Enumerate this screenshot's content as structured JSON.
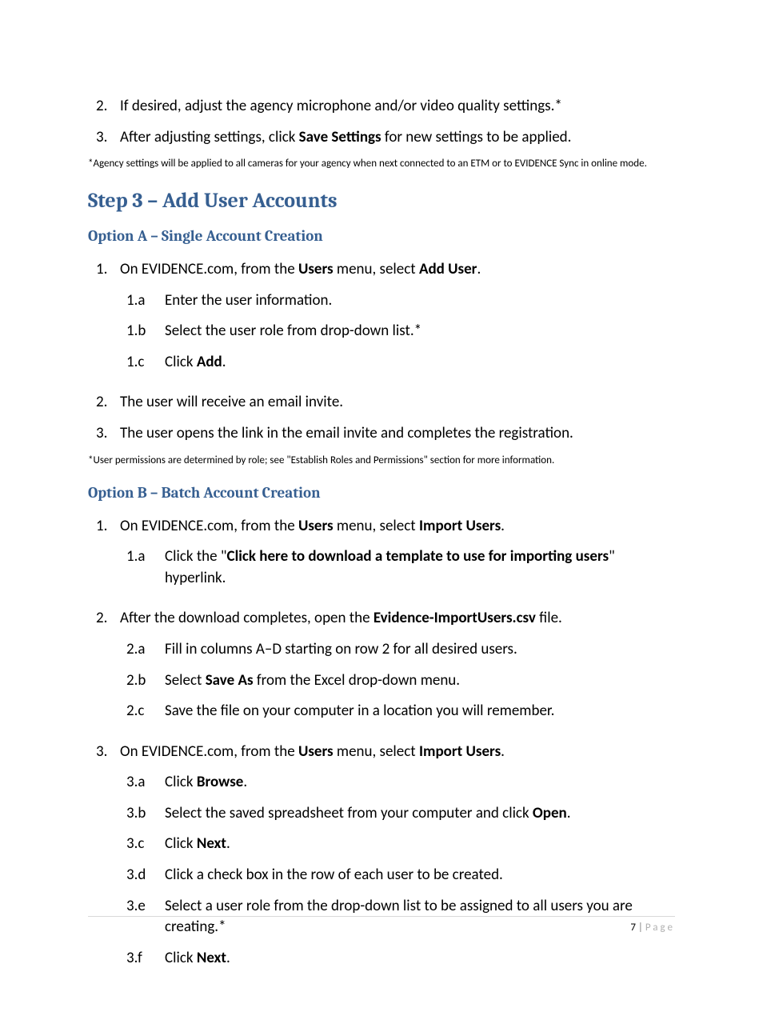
{
  "top": {
    "items": [
      {
        "n": "2.",
        "text": "If desired, adjust the agency microphone and/or video quality settings.*"
      },
      {
        "n": "3.",
        "pre": "After adjusting settings, click ",
        "bold": "Save Settings",
        "post": " for new settings to be applied."
      }
    ],
    "footnote": "*Agency settings will be applied to all cameras for your agency when next connected to an ETM or to EVIDENCE Sync in online mode."
  },
  "step_heading": "Step 3 – Add User Accounts",
  "optionA": {
    "title": "Option A – Single Account Creation",
    "item1": {
      "n": "1.",
      "pre": "On EVIDENCE.com, from the ",
      "b1": "Users",
      "mid": " menu, select ",
      "b2": "Add User",
      "post": ".",
      "subs": [
        {
          "n": "1.a",
          "text": "Enter the user information."
        },
        {
          "n": "1.b",
          "text": "Select the user role from drop-down list.*"
        },
        {
          "n": "1.c",
          "pre": "Click ",
          "bold": "Add",
          "post": "."
        }
      ]
    },
    "item2": {
      "n": "2.",
      "text": "The user will receive an email invite."
    },
    "item3": {
      "n": "3.",
      "text": "The user opens the link in the email invite and completes the registration."
    },
    "footnote": "*User permissions are determined by role; see \"Establish Roles and Permissions\" section for more information."
  },
  "optionB": {
    "title": "Option B – Batch Account Creation",
    "item1": {
      "n": "1.",
      "pre": "On EVIDENCE.com, from the ",
      "b1": "Users",
      "mid": " menu, select ",
      "b2": "Import Users",
      "post": ".",
      "subs": [
        {
          "n": "1.a",
          "pre": "Click the \"",
          "bold": "Click here to download a template to use for importing users",
          "post": "\" hyperlink."
        }
      ]
    },
    "item2": {
      "n": "2.",
      "pre": "After the download completes, open the ",
      "bold": "Evidence-ImportUsers.csv",
      "post": " file.",
      "subs": [
        {
          "n": "2.a",
          "text": "Fill in columns A–D starting on row 2 for all desired users."
        },
        {
          "n": "2.b",
          "pre": "Select ",
          "bold": "Save As",
          "post": " from the Excel drop-down menu."
        },
        {
          "n": "2.c",
          "text": "Save the file on your computer in a location you will remember."
        }
      ]
    },
    "item3": {
      "n": "3.",
      "pre": "On EVIDENCE.com, from the ",
      "b1": "Users",
      "mid": " menu, select ",
      "b2": "Import Users",
      "post": ".",
      "subs": [
        {
          "n": "3.a",
          "pre": "Click ",
          "bold": "Browse",
          "post": "."
        },
        {
          "n": "3.b",
          "pre": "Select the saved spreadsheet from your computer and click ",
          "bold": "Open",
          "post": "."
        },
        {
          "n": "3.c",
          "pre": "Click ",
          "bold": "Next",
          "post": "."
        },
        {
          "n": "3.d",
          "text": "Click a check box in the row of each user to be created."
        },
        {
          "n": "3.e",
          "text": "Select a user role from the drop-down list to be assigned to all users you are creating.*"
        },
        {
          "n": "3.f",
          "pre": "Click ",
          "bold": "Next",
          "post": "."
        }
      ]
    }
  },
  "footer": {
    "num": "7",
    "sep": " | ",
    "label": "Page"
  }
}
